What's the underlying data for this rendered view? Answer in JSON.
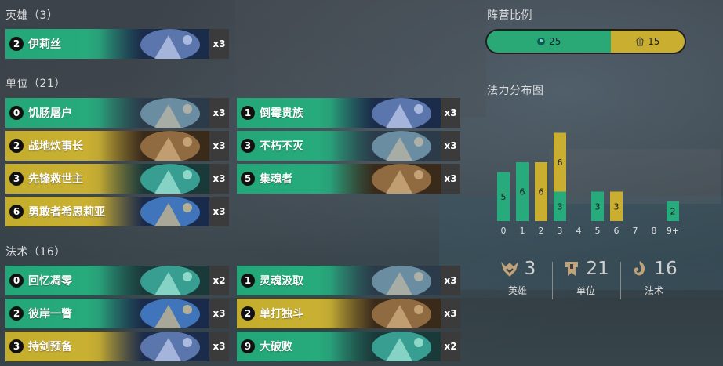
{
  "sections": {
    "champions": "英雄（3）",
    "units": "单位（21）",
    "spells": "法术（16）",
    "region_ratio": "阵营比例",
    "mana_curve": "法力分布图"
  },
  "colors": {
    "green": "#27aa7c",
    "gold": "#c9ae2f",
    "count_bg": "#3b3b3b"
  },
  "champions": [
    {
      "cost": "2",
      "name": "伊莉丝",
      "count": "x3",
      "region": "green"
    }
  ],
  "units_left": [
    {
      "cost": "0",
      "name": "饥肠屠户",
      "count": "x3",
      "region": "green"
    },
    {
      "cost": "2",
      "name": "战地炊事长",
      "count": "x3",
      "region": "gold"
    },
    {
      "cost": "3",
      "name": "先锋救世主",
      "count": "x3",
      "region": "gold"
    },
    {
      "cost": "6",
      "name": "勇敢者希思莉亚",
      "count": "x3",
      "region": "gold"
    }
  ],
  "units_right": [
    {
      "cost": "1",
      "name": "倒霉贵族",
      "count": "x3",
      "region": "green"
    },
    {
      "cost": "3",
      "name": "不朽不灭",
      "count": "x3",
      "region": "green"
    },
    {
      "cost": "5",
      "name": "集魂者",
      "count": "x3",
      "region": "green"
    }
  ],
  "spells_left": [
    {
      "cost": "0",
      "name": "回忆凋零",
      "count": "x2",
      "region": "green"
    },
    {
      "cost": "2",
      "name": "彼岸一瞥",
      "count": "x3",
      "region": "green"
    },
    {
      "cost": "3",
      "name": "持剑预备",
      "count": "x3",
      "region": "gold"
    }
  ],
  "spells_right": [
    {
      "cost": "1",
      "name": "灵魂汲取",
      "count": "x3",
      "region": "green"
    },
    {
      "cost": "2",
      "name": "单打独斗",
      "count": "x3",
      "region": "gold"
    },
    {
      "cost": "9",
      "name": "大破败",
      "count": "x2",
      "region": "green"
    }
  ],
  "region_bar": {
    "shadow_isles": {
      "icon": "shadow-isles-icon",
      "value": "25",
      "fraction": 0.625
    },
    "demacia": {
      "icon": "demacia-icon",
      "value": "15",
      "fraction": 0.375
    }
  },
  "chart_data": {
    "type": "bar",
    "categories": [
      "0",
      "1",
      "2",
      "3",
      "4",
      "5",
      "6",
      "7",
      "8",
      "9+"
    ],
    "series": [
      {
        "values": [
          5,
          6,
          0,
          3,
          0,
          3,
          0,
          0,
          0,
          2
        ],
        "color": "#27aa7c"
      },
      {
        "values": [
          0,
          0,
          6,
          6,
          0,
          0,
          3,
          0,
          0,
          0
        ],
        "color": "#c9ae2f"
      }
    ],
    "stacked": true
  },
  "stats": [
    {
      "icon": "champion-icon",
      "value": "3",
      "label": "英雄"
    },
    {
      "icon": "unit-icon",
      "value": "21",
      "label": "单位"
    },
    {
      "icon": "spell-icon",
      "value": "16",
      "label": "法术"
    }
  ]
}
